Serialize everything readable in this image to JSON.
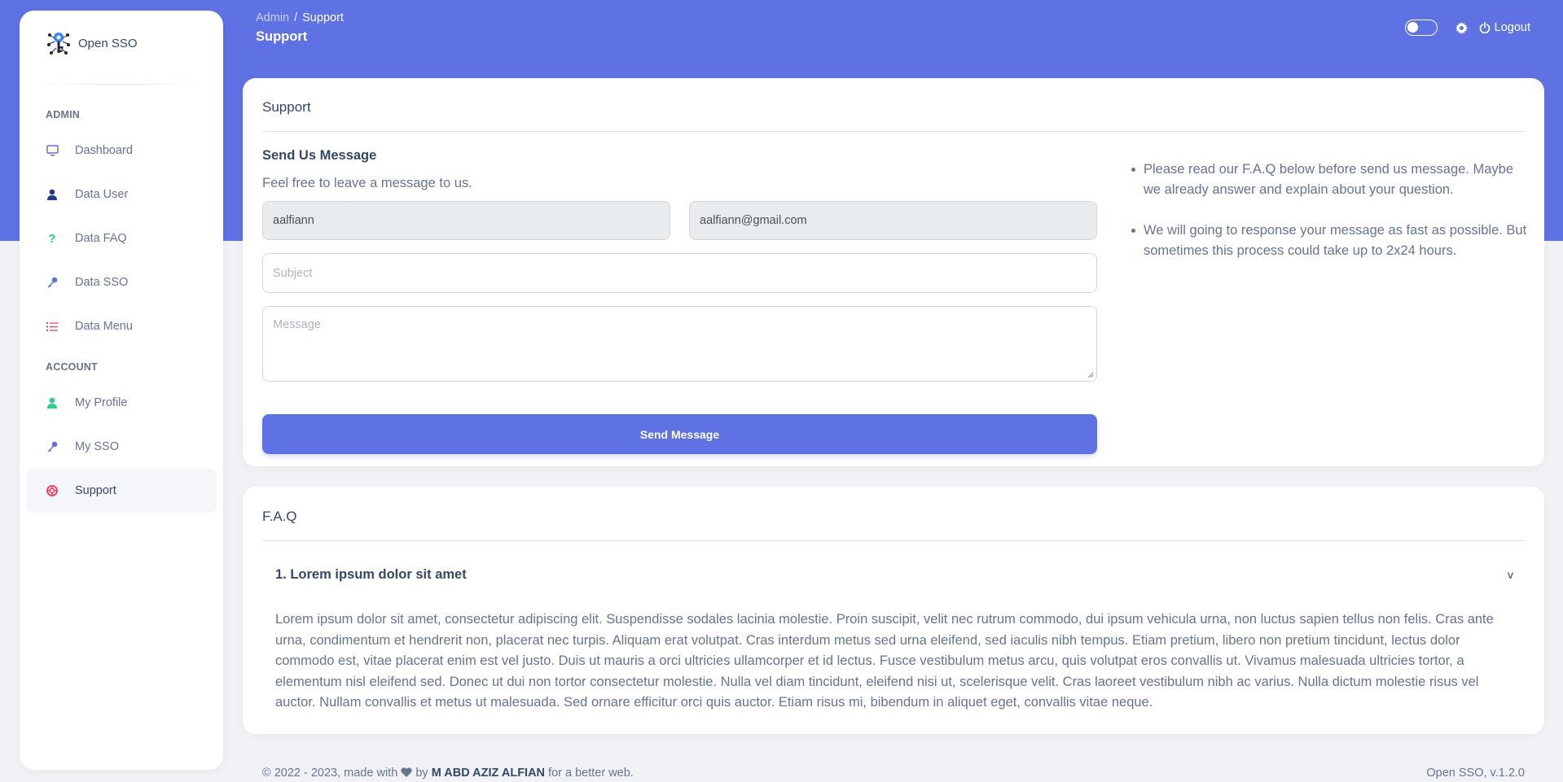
{
  "brand": {
    "name": "Open SSO"
  },
  "sidebar": {
    "sections": [
      {
        "title": "ADMIN",
        "items": [
          {
            "label": "Dashboard",
            "icon": "monitor-icon",
            "color": "#5e72e4"
          },
          {
            "label": "Data User",
            "icon": "user-icon",
            "color": "#1e3a8a"
          },
          {
            "label": "Data FAQ",
            "icon": "question-icon",
            "color": "#2dce89"
          },
          {
            "label": "Data SSO",
            "icon": "key-icon",
            "color": "#5e72e4"
          },
          {
            "label": "Data Menu",
            "icon": "list-icon",
            "color": "#f5365c"
          }
        ]
      },
      {
        "title": "ACCOUNT",
        "items": [
          {
            "label": "My Profile",
            "icon": "user-icon",
            "color": "#2dce89"
          },
          {
            "label": "My SSO",
            "icon": "key-icon",
            "color": "#5e72e4"
          },
          {
            "label": "Support",
            "icon": "lifebuoy-icon",
            "color": "#f5365c",
            "active": true
          }
        ]
      }
    ]
  },
  "header": {
    "breadcrumb": [
      "Admin",
      "Support"
    ],
    "title": "Support",
    "logout_label": "Logout"
  },
  "support_card": {
    "title": "Support",
    "form_title": "Send Us Message",
    "form_subtitle": "Feel free to leave a message to us.",
    "name_value": "aalfiann",
    "email_value": "aalfiann@gmail.com",
    "subject_placeholder": "Subject",
    "message_placeholder": "Message",
    "send_label": "Send Message",
    "notes": [
      "Please read our F.A.Q below before send us message. Maybe we already answer and explain about your question.",
      "We will going to response your message as fast as possible. But sometimes this process could take up to 2x24 hours."
    ]
  },
  "faq_card": {
    "title": "F.A.Q",
    "question": "1. Lorem ipsum dolor sit amet",
    "chevron": "v",
    "answer": "Lorem ipsum dolor sit amet, consectetur adipiscing elit. Suspendisse sodales lacinia molestie. Proin suscipit, velit nec rutrum commodo, dui ipsum vehicula urna, non luctus sapien tellus non felis. Cras ante urna, condimentum et hendrerit non, placerat nec turpis. Aliquam erat volutpat. Cras interdum metus sed urna eleifend, sed iaculis nibh tempus. Etiam pretium, libero non pretium tincidunt, lectus dolor commodo est, vitae placerat enim est vel justo. Duis ut mauris a orci ultricies ullamcorper et id lectus. Fusce vestibulum metus arcu, quis volutpat eros convallis ut. Vivamus malesuada ultricies tortor, a elementum nisl eleifend sed. Donec ut dui non tortor consectetur molestie. Nulla vel diam tincidunt, eleifend nisi ut, scelerisque velit. Cras laoreet vestibulum nibh ac varius. Nulla dictum molestie risus vel auctor. Nullam convallis et metus ut malesuada. Sed ornare efficitur orci quis auctor. Etiam risus mi, bibendum in aliquet eget, convallis vitae neque."
  },
  "footer": {
    "prefix": "© 2022 - 2023, made with",
    "by": "by",
    "author": "M ABD AZIZ ALFIAN",
    "suffix": "for a better web.",
    "version": "Open SSO, v.1.2.0"
  },
  "colors": {
    "primary": "#5e72e4",
    "text": "#344767",
    "muted": "#67748e",
    "bg": "#f0f2f5"
  }
}
